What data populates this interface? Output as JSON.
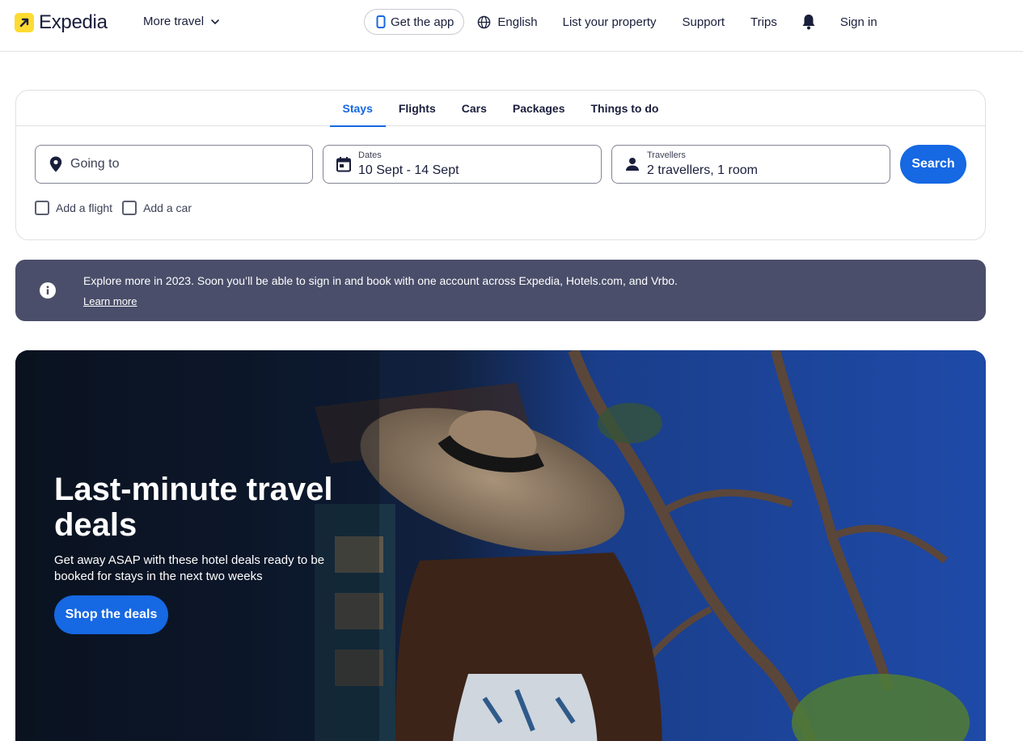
{
  "brand": {
    "name": "Expedia",
    "logo_color": "#fddb32"
  },
  "header": {
    "more_travel": "More travel",
    "get_app": "Get the app",
    "language": "English",
    "list_property": "List your property",
    "support": "Support",
    "trips": "Trips",
    "sign_in": "Sign in"
  },
  "search": {
    "tabs": [
      {
        "label": "Stays",
        "active": true
      },
      {
        "label": "Flights",
        "active": false
      },
      {
        "label": "Cars",
        "active": false
      },
      {
        "label": "Packages",
        "active": false
      },
      {
        "label": "Things to do",
        "active": false
      }
    ],
    "going_to": {
      "placeholder": "Going to"
    },
    "dates": {
      "label": "Dates",
      "value": "10 Sept - 14 Sept"
    },
    "travellers": {
      "label": "Travellers",
      "value": "2 travellers, 1 room"
    },
    "search_button": "Search",
    "add_flight": "Add a flight",
    "add_car": "Add a car"
  },
  "banner": {
    "message": "Explore more in 2023. Soon you’ll be able to sign in and book with one account across Expedia, Hotels.com, and Vrbo.",
    "link": "Learn more"
  },
  "hero": {
    "title": "Last-minute travel deals",
    "subtitle": "Get away ASAP with these hotel deals ready to be booked for stays in the next two weeks",
    "cta": "Shop the deals"
  },
  "colors": {
    "accent": "#1668e3",
    "banner_bg": "#4a4e6a",
    "text": "#191e3b"
  }
}
